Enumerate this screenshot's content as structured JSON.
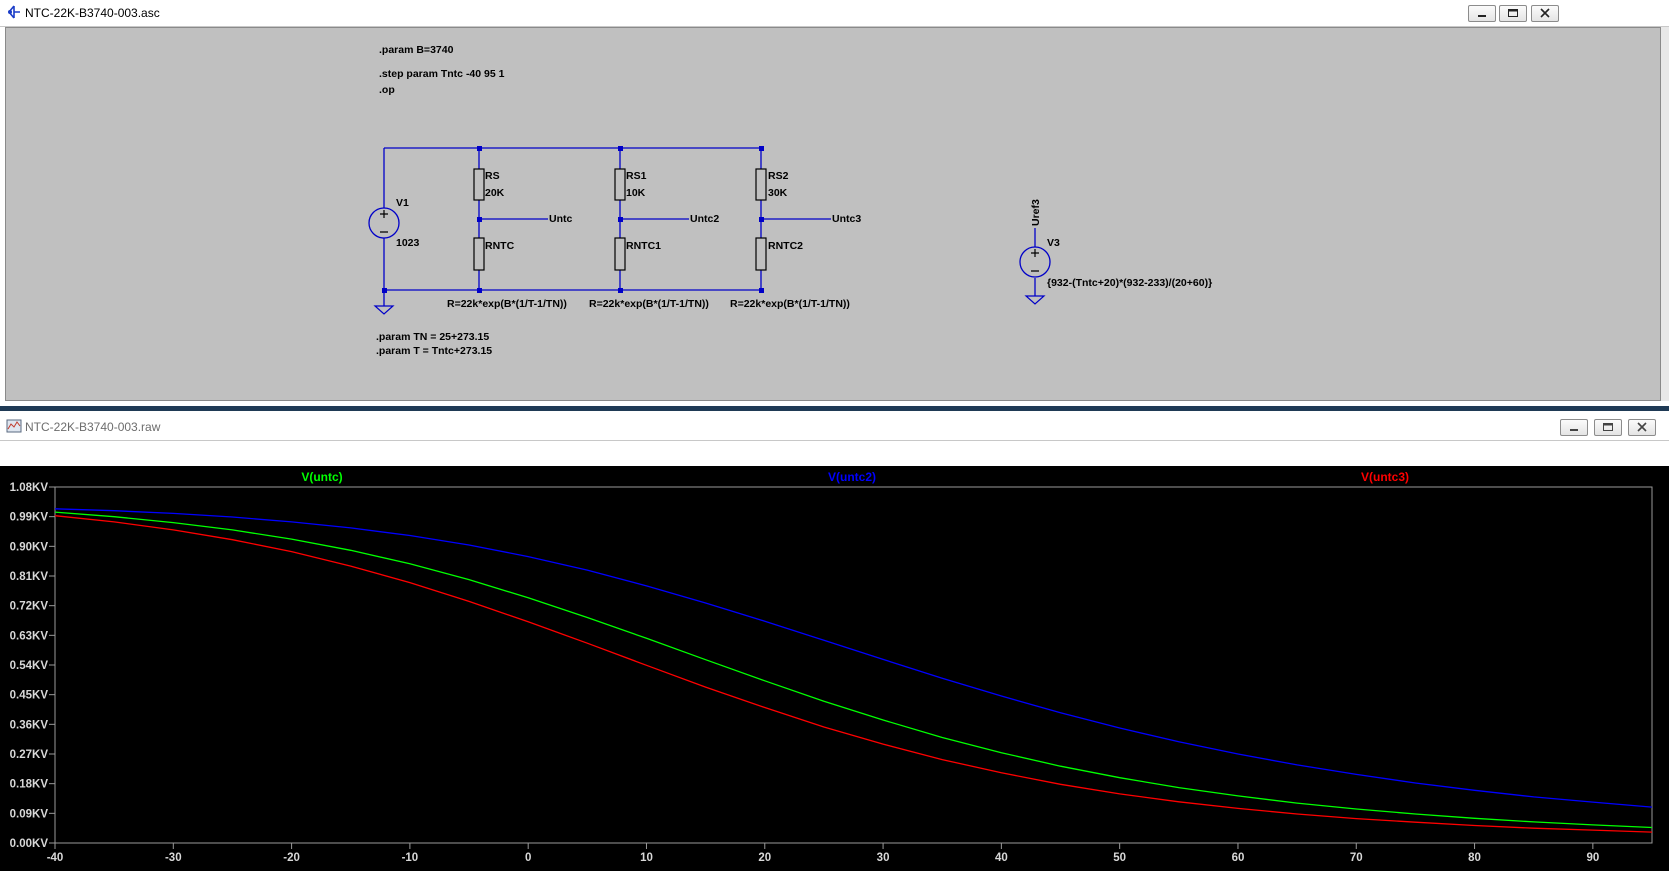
{
  "schematic_window": {
    "title": "NTC-22K-B3740-003.asc",
    "directives": {
      "param_b": ".param B=3740",
      "step": ".step param Tntc -40 95 1",
      "op": ".op",
      "param_tn": ".param TN = 25+273.15",
      "param_t": ".param T = Tntc+273.15"
    },
    "components": {
      "v1_name": "V1",
      "v1_value": "1023",
      "rs_name": "RS",
      "rs_value": "20K",
      "rs1_name": "RS1",
      "rs1_value": "10K",
      "rs2_name": "RS2",
      "rs2_value": "30K",
      "rntc_name": "RNTC",
      "rntc1_name": "RNTC1",
      "rntc2_name": "RNTC2",
      "rntc_expr": "R=22k*exp(B*(1/T-1/TN))",
      "rntc1_expr": "R=22k*exp(B*(1/T-1/TN))",
      "rntc2_expr": "R=22k*exp(B*(1/T-1/TN))",
      "v3_name": "V3",
      "v3_value": "{932-(Tntc+20)*(932-233)/(20+60)}"
    },
    "nets": {
      "untc": "Untc",
      "untc2": "Untc2",
      "untc3": "Untc3",
      "uref3": "Uref3"
    },
    "wire_color": "#0000c8"
  },
  "plot_window": {
    "title": "NTC-22K-B3740-003.raw",
    "background": "#000000"
  },
  "chart_data": {
    "type": "line",
    "xlabel": "",
    "ylabel": "",
    "xlim": [
      -40,
      95
    ],
    "ylim": [
      0,
      1.08
    ],
    "x_ticks": [
      -40,
      -30,
      -20,
      -10,
      0,
      10,
      20,
      30,
      40,
      50,
      60,
      70,
      80,
      90
    ],
    "x_tick_labels": [
      "-40",
      "-30",
      "-20",
      "-10",
      "0",
      "10",
      "20",
      "30",
      "40",
      "50",
      "60",
      "70",
      "80",
      "90"
    ],
    "y_ticks": [
      0,
      0.09,
      0.18,
      0.27,
      0.36,
      0.45,
      0.54,
      0.63,
      0.72,
      0.81,
      0.9,
      0.99,
      1.08
    ],
    "y_tick_labels": [
      "0.00KV",
      "0.09KV",
      "0.18KV",
      "0.27KV",
      "0.36KV",
      "0.45KV",
      "0.54KV",
      "0.63KV",
      "0.72KV",
      "0.81KV",
      "0.90KV",
      "0.99KV",
      "1.08KV"
    ],
    "grid": false,
    "legend": "top",
    "x": [
      -40,
      -35,
      -30,
      -25,
      -20,
      -15,
      -10,
      -5,
      0,
      5,
      10,
      15,
      20,
      25,
      30,
      35,
      40,
      45,
      50,
      55,
      60,
      65,
      70,
      75,
      80,
      85,
      90,
      95
    ],
    "series": [
      {
        "name": "V(untc)",
        "color": "#00ff00",
        "values": [
          1.004,
          0.99,
          0.972,
          0.95,
          0.922,
          0.888,
          0.847,
          0.799,
          0.744,
          0.684,
          0.621,
          0.556,
          0.492,
          0.43,
          0.373,
          0.32,
          0.274,
          0.233,
          0.198,
          0.168,
          0.143,
          0.121,
          0.103,
          0.088,
          0.075,
          0.064,
          0.055,
          0.047
        ]
      },
      {
        "name": "V(untc2)",
        "color": "#0000ff",
        "values": [
          1.014,
          1.008,
          1.0,
          0.989,
          0.974,
          0.956,
          0.933,
          0.904,
          0.869,
          0.828,
          0.78,
          0.728,
          0.673,
          0.615,
          0.557,
          0.5,
          0.446,
          0.395,
          0.349,
          0.307,
          0.27,
          0.237,
          0.208,
          0.182,
          0.16,
          0.14,
          0.124,
          0.109
        ]
      },
      {
        "name": "V(untc3)",
        "color": "#ff0000",
        "values": [
          0.993,
          0.974,
          0.95,
          0.92,
          0.884,
          0.84,
          0.79,
          0.733,
          0.671,
          0.606,
          0.539,
          0.473,
          0.411,
          0.352,
          0.3,
          0.253,
          0.213,
          0.178,
          0.149,
          0.125,
          0.105,
          0.088,
          0.074,
          0.063,
          0.053,
          0.045,
          0.039,
          0.033
        ]
      }
    ]
  }
}
